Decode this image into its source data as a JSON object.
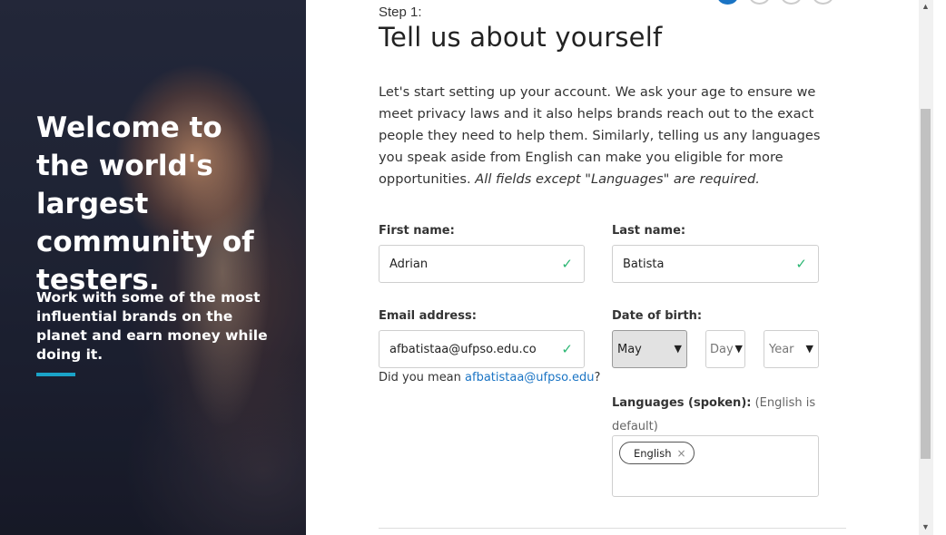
{
  "hero": {
    "title": "Welcome to the world's largest community of testers.",
    "subtitle": "Work with some of the most influential brands on the planet and earn money while doing it.",
    "accent_color": "#1aa3c8"
  },
  "progress": {
    "total_steps": 4,
    "current_step": 1
  },
  "form": {
    "step_label": "Step 1:",
    "title": "Tell us about yourself",
    "intro_text": "Let's start setting up your account. We ask your age to ensure we meet privacy laws and it also helps brands reach out to the exact people they need to help them. Similarly, telling us any languages you speak aside from English can make you eligible for more opportunities. ",
    "intro_emphasis": "All fields except \"Languages\" are required.",
    "first_name": {
      "label": "First name:",
      "value": "Adrian"
    },
    "last_name": {
      "label": "Last name:",
      "value": "Batista"
    },
    "email": {
      "label": "Email address:",
      "value": "afbatistaa@ufpso.edu.co"
    },
    "email_suggestion": {
      "prefix": "Did you mean ",
      "link": "afbatistaa@ufpso.edu",
      "suffix": "?"
    },
    "dob": {
      "label": "Date of birth:",
      "month": "May",
      "day": "Day",
      "year": "Year"
    },
    "languages": {
      "label": "Languages (spoken):",
      "note": " (English is default)",
      "chips": [
        "English"
      ]
    }
  },
  "icons": {
    "valid": "checkmark-icon",
    "remove": "close-icon",
    "select": "chevron-down-icon"
  }
}
